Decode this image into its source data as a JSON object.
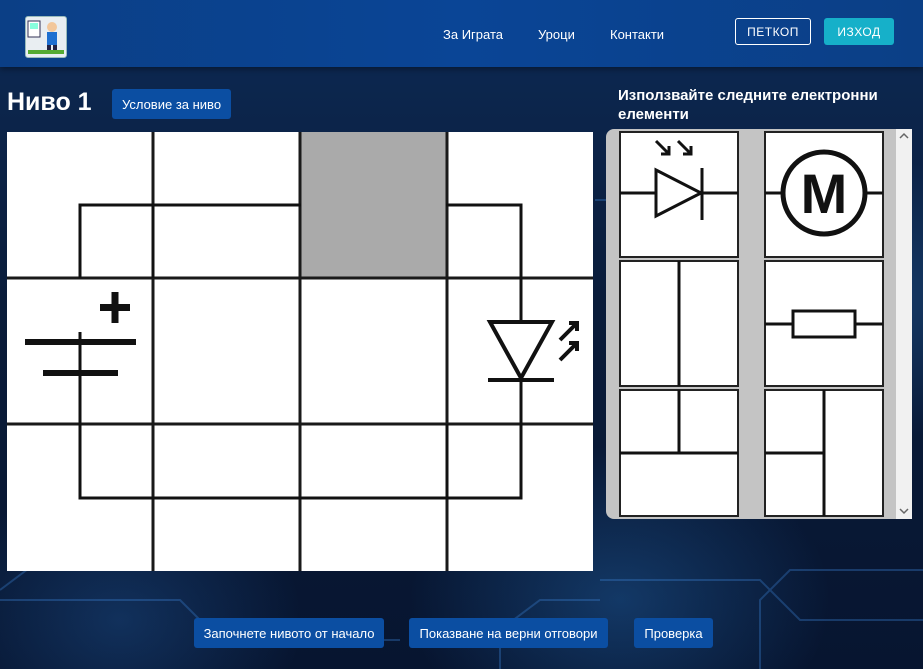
{
  "nav": {
    "about": "За Играта",
    "lessons": "Уроци",
    "contacts": "Контакти",
    "user": "ПЕТКОП",
    "logout": "ИЗХОД"
  },
  "level": {
    "title": "Ниво 1",
    "condition_button": "Условие за ниво"
  },
  "palette": {
    "title": "Използвайте следните електронни елементи",
    "items": [
      "photodiode",
      "motor",
      "wire-straight",
      "resistor",
      "wire-corner",
      "wire-t"
    ]
  },
  "actions": {
    "restart": "Започнете нивото от начало",
    "show_answers": "Показване на верни отговори",
    "check": "Проверка"
  },
  "colors": {
    "accent": "#0b4ea2",
    "exit": "#16b0c9",
    "empty_cell": "#aaaaaa"
  }
}
